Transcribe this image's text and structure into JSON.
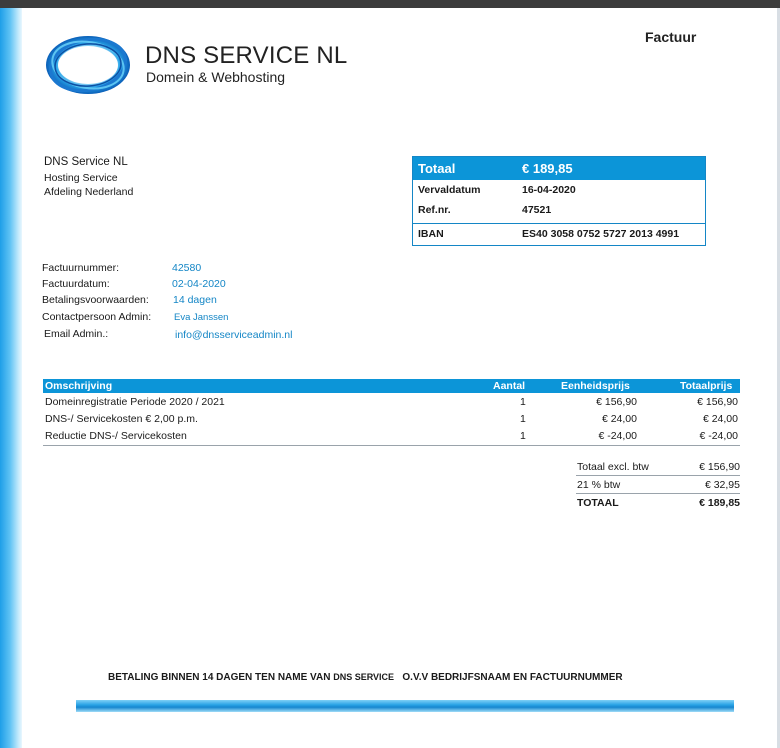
{
  "company": {
    "name": "DNS SERVICE NL",
    "tagline": "Domein & Webhosting"
  },
  "document_title": "Factuur",
  "sender": {
    "line1": "DNS Service NL",
    "line2": "Hosting Service",
    "line3": "Afdeling Nederland"
  },
  "summary": {
    "total_label": "Totaal",
    "total_value": "€ 189,85",
    "due_label": "Vervaldatum",
    "due_value": "16-04-2020",
    "ref_label": "Ref.nr.",
    "ref_value": "47521",
    "iban_label": "IBAN",
    "iban_value": "ES40 3058 0752 5727 2013 4991"
  },
  "details": {
    "invoice_number_label": "Factuurnummer:",
    "invoice_number": "42580",
    "invoice_date_label": "Factuurdatum:",
    "invoice_date": "02-04-2020",
    "terms_label": "Betalingsvoorwaarden:",
    "terms": "14 dagen",
    "contact_label": "Contactpersoon Admin:",
    "contact": "Eva Janssen",
    "email_label": "Email Admin.:",
    "email": "info@dnsserviceadmin.nl"
  },
  "items": {
    "headers": {
      "description": "Omschrijving",
      "quantity": "Aantal",
      "unit_price": "Eenheidsprijs",
      "total_price": "Totaalprijs"
    },
    "rows": [
      {
        "description": "Domeinregistratie Periode 2020 / 2021",
        "quantity": "1",
        "unit_price": "€ 156,90",
        "total_price": "€ 156,90"
      },
      {
        "description": "DNS-/ Servicekosten € 2,00 p.m.",
        "quantity": "1",
        "unit_price": "€ 24,00",
        "total_price": "€ 24,00"
      },
      {
        "description": "Reductie DNS-/ Servicekosten",
        "quantity": "1",
        "unit_price": "€ -24,00",
        "total_price": "€ -24,00"
      }
    ]
  },
  "totals": {
    "excl_label": "Totaal excl. btw",
    "excl_value": "€ 156,90",
    "vat_label": "21 % btw",
    "vat_value": "€ 32,95",
    "total_label": "TOTAAL",
    "total_value": "€ 189,85"
  },
  "footer": {
    "note_part1": "BETALING BINNEN 14 DAGEN TEN NAME  VAN",
    "note_part2": "DNS SERVICE",
    "note_part3": "O.V.V BEDRIJFSNAAM EN FACTUURNUMMER"
  },
  "colors": {
    "accent": "#0c95d8",
    "link": "#1486c6"
  }
}
